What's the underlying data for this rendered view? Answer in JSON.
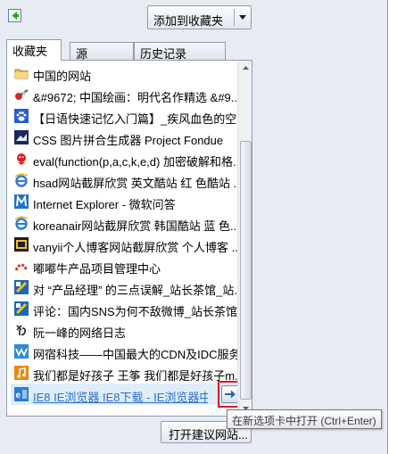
{
  "toolbar": {
    "add_to_favorites_label": "添加到收藏夹"
  },
  "tabs": [
    {
      "label": "收藏夹",
      "active": true
    },
    {
      "label": "源",
      "active": false
    },
    {
      "label": "历史记录",
      "active": false
    }
  ],
  "favorites": [
    {
      "label": "中国的网站",
      "icon": "folder-icon"
    },
    {
      "label": "&#9672; 中国绘画：明代名作精选 &#9...",
      "icon": "painting-icon"
    },
    {
      "label": "【日语快速记忆入门篇】_疾风血色的空...",
      "icon": "paw-icon"
    },
    {
      "label": "CSS 图片拼合生成器  Project Fondue",
      "icon": "css-icon"
    },
    {
      "label": "eval(function(p,a,c,k,e,d) 加密破解和格...",
      "icon": "baidu-icon"
    },
    {
      "label": "hsad网站截屏欣赏 英文酷站 红 色酷站 ...",
      "icon": "ie-icon"
    },
    {
      "label": "Internet Explorer - 微软问答",
      "icon": "microsoft-icon"
    },
    {
      "label": "koreanair网站截屏欣赏 韩国酷站 蓝 色...",
      "icon": "ie-icon"
    },
    {
      "label": "vanyii个人博客网站截屏欣赏 个人博客 ...",
      "icon": "vanyii-icon"
    },
    {
      "label": "嘟嘟牛产品项目管理中心",
      "icon": "arc-icon"
    },
    {
      "label": "对 “产品经理” 的三点误解_站长茶馆_站...",
      "icon": "chinaz-icon"
    },
    {
      "label": "评论：国内SNS为何不敌微博_站长茶馆_...",
      "icon": "chinaz-icon"
    },
    {
      "label": "阮一峰的网络日志",
      "icon": "ruanyifeng-icon"
    },
    {
      "label": "网宿科技——中国最大的CDN及IDC服务...",
      "icon": "wangsu-icon"
    },
    {
      "label": "我们都是好孩子 王筝 我们都是好孩子m...",
      "icon": "baidu-music-icon"
    },
    {
      "label": "IE8 IE浏览器 IE8下载 - IE浏览器中...",
      "icon": "ie8-icon",
      "highlighted": true
    }
  ],
  "bottom_button_label": "打开建议网站...",
  "tooltip": "在新选项卡中打开 (Ctrl+Enter)",
  "colors": {
    "highlight_text": "#2b6fc7",
    "annotation_box": "#e0141b"
  }
}
